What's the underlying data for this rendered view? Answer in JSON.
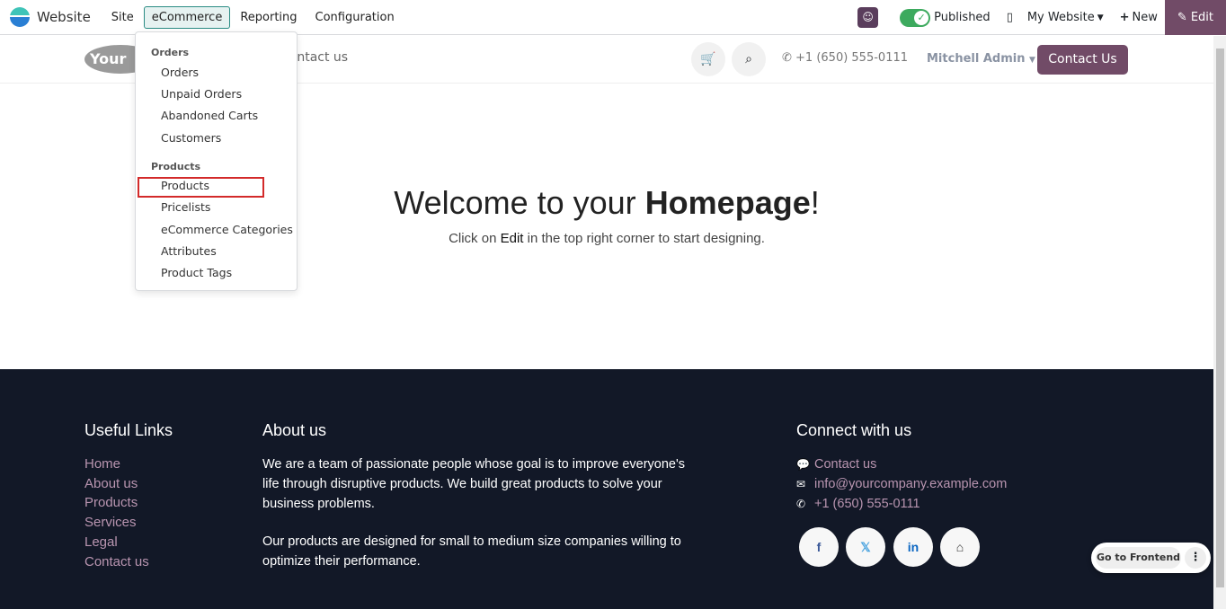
{
  "topbar": {
    "app": "Website",
    "menus": [
      "Site",
      "eCommerce",
      "Reporting",
      "Configuration"
    ],
    "published": "Published",
    "website": "My Website",
    "new": "New",
    "edit": "Edit"
  },
  "dropdown": {
    "orders_header": "Orders",
    "orders": [
      "Orders",
      "Unpaid Orders",
      "Abandoned Carts",
      "Customers"
    ],
    "products_header": "Products",
    "products": [
      "Products",
      "Pricelists",
      "eCommerce Categories",
      "Attributes",
      "Product Tags"
    ],
    "highlighted": "Products"
  },
  "header": {
    "logo": "YourLogo",
    "nav": "Contact us",
    "phone": "+1 (650) 555-0111",
    "user": "Mitchell Admin",
    "contact_btn": "Contact Us"
  },
  "hero": {
    "title_pre": "Welcome to your ",
    "title_bold": "Homepage",
    "title_post": "!",
    "sub_pre": "Click on ",
    "sub_bold": "Edit",
    "sub_post": " in the top right corner to start designing."
  },
  "footer": {
    "useful_title": "Useful Links",
    "links": [
      "Home",
      "About us",
      "Products",
      "Services",
      "Legal",
      "Contact us"
    ],
    "about_title": "About us",
    "about_p1": "We are a team of passionate people whose goal is to improve everyone's life through disruptive products. We build great products to solve your business problems.",
    "about_p2": "Our products are designed for small to medium size companies willing to optimize their performance.",
    "connect_title": "Connect with us",
    "contact": "Contact us",
    "email": "info@yourcompany.example.com",
    "phone": "+1 (650) 555-0111",
    "social": [
      "facebook-icon",
      "x-icon",
      "linkedin-icon",
      "home-icon"
    ]
  },
  "frontend": {
    "label": "Go to Frontend"
  },
  "colors": {
    "brand": "#714b67",
    "footer_bg": "#121827",
    "highlight": "#d32a2a"
  }
}
